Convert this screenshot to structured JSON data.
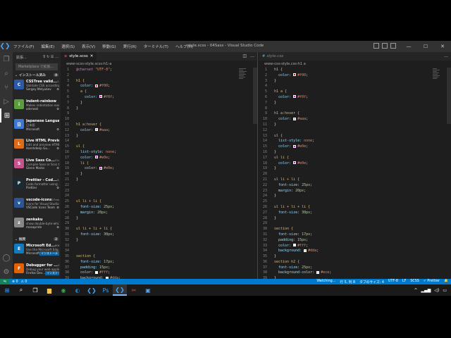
{
  "window": {
    "title": "style.scss - 04Sass - Visual Studio Code",
    "menus": [
      "ファイル(F)",
      "編集(E)",
      "選択(S)",
      "表示(V)",
      "移動(G)",
      "実行(R)",
      "ターミナル(T)",
      "ヘルプ(H)"
    ],
    "controls": {
      "minimize": "—",
      "maximize": "☐",
      "close": "✕"
    }
  },
  "sidebar": {
    "title": "拡張...",
    "search_placeholder": "Marketplace で拡張...",
    "installed_label": "インストール済み",
    "installed_count": "9",
    "recommended_label": "推奨",
    "recommended_count": "2",
    "extensions": [
      {
        "name": "CSSTree valid...",
        "meta": "116ms",
        "desc": "Validate CSS according...",
        "publisher": "Sergey Melyukov",
        "color": "#2a5aa8",
        "letter": "C"
      },
      {
        "name": "indent-rainbow",
        "meta": "",
        "desc": "Makes indentation easi...",
        "publisher": "oderwat",
        "color": "#5a9e3e",
        "letter": "i"
      },
      {
        "name": "Japanese Language P...",
        "meta": "",
        "desc": "日本語",
        "publisher": "Microsoft",
        "color": "#3c78d8",
        "letter": "日"
      },
      {
        "name": "Live HTML Previewer",
        "meta": "",
        "desc": "Edit and preview HTML...",
        "publisher": "Harshdeep Gu...",
        "color": "#e06c1a",
        "letter": "L"
      },
      {
        "name": "Live Sass Co...",
        "meta": "21ms",
        "desc": "Compile Sass or Scss t...",
        "publisher": "Glenn Marks",
        "color": "#c6538c",
        "letter": "S"
      },
      {
        "name": "Prettier - Cod...",
        "meta": "34ms",
        "desc": "Code formatter using ...",
        "publisher": "Prettier",
        "color": "#1a2b34",
        "letter": "P"
      },
      {
        "name": "vscode-icons",
        "meta": "27ms",
        "desc": "Icons for Visual Studio ...",
        "publisher": "VSCode Icons Team",
        "color": "#2b5797",
        "letter": "v"
      },
      {
        "name": "zenkaku",
        "meta": "",
        "desc": "show double-byte-whi...",
        "publisher": "mosapride",
        "color": "#888888",
        "letter": "z"
      }
    ],
    "recommended": [
      {
        "name": "Microsoft Ed...",
        "meta": "60K",
        "desc": "Use the Microsoft Edg...",
        "publisher": "Microsoft",
        "install": "インストール",
        "color": "#0f7bc2",
        "letter": "E"
      },
      {
        "name": "Debugger for ...",
        "meta": "2M",
        "desc": "Debug your web applic...",
        "publisher": "Firefox Dev...",
        "install": "インストール",
        "color": "#e66000",
        "letter": "F"
      }
    ]
  },
  "editor_left": {
    "tab": "style.scss",
    "breadcrumb": [
      "www",
      "scss",
      "style.scss",
      "h1",
      "a"
    ],
    "lines": [
      [
        "ln",
        "1",
        "@charset ",
        "kw",
        "\"UTF-8\"",
        "val",
        ";",
        "txt"
      ],
      [
        "ln",
        "2"
      ],
      [
        "ln",
        "3",
        "h1 {",
        "sel"
      ],
      [
        "ln",
        "4",
        "  color: ",
        "prop",
        "#f00",
        "val",
        ";",
        "txt"
      ],
      [
        "ln",
        "5",
        "  a {",
        "sel"
      ],
      [
        "ln",
        "6",
        "    color: ",
        "prop",
        "#f0f",
        "val",
        ";",
        "txt"
      ],
      [
        "ln",
        "7",
        "  }",
        "txt"
      ],
      [
        "ln",
        "8",
        "}",
        "txt"
      ],
      [
        "ln",
        "9"
      ],
      [
        "ln",
        "10"
      ],
      [
        "ln",
        "11",
        "h1 a:hover {",
        "sel"
      ],
      [
        "ln",
        "12",
        "  color: ",
        "prop",
        "#aaa",
        "val",
        ";",
        "txt"
      ],
      [
        "ln",
        "13",
        "}",
        "txt"
      ],
      [
        "ln",
        "14"
      ],
      [
        "ln",
        "15",
        "ul {",
        "sel"
      ],
      [
        "ln",
        "16",
        "  list-style: ",
        "prop",
        "none",
        "val",
        ";",
        "txt"
      ],
      [
        "ln",
        "17",
        "  color: ",
        "prop",
        "#e0e",
        "val",
        ";",
        "txt"
      ],
      [
        "ln",
        "18",
        "  li {",
        "sel"
      ],
      [
        "ln",
        "19",
        "    color: ",
        "prop",
        "#e0e",
        "val",
        ";",
        "txt"
      ],
      [
        "ln",
        "20",
        "  }",
        "txt"
      ],
      [
        "ln",
        "21",
        "}",
        "txt"
      ],
      [
        "ln",
        "22"
      ],
      [
        "ln",
        "23"
      ],
      [
        "ln",
        "24"
      ],
      [
        "ln",
        "25",
        "ul li + li {",
        "sel"
      ],
      [
        "ln",
        "26",
        "  font-size: ",
        "prop",
        "25px",
        "num",
        ";",
        "txt"
      ],
      [
        "ln",
        "27",
        "  margin: ",
        "prop",
        "20px",
        "num",
        ";",
        "txt"
      ],
      [
        "ln",
        "28",
        "}",
        "txt"
      ],
      [
        "ln",
        "29"
      ],
      [
        "ln",
        "30",
        "ul li + li + li {",
        "sel"
      ],
      [
        "ln",
        "31",
        "  font-size: ",
        "prop",
        "30px",
        "num",
        ";",
        "txt"
      ],
      [
        "ln",
        "32",
        "}",
        "txt"
      ],
      [
        "ln",
        "33"
      ],
      [
        "ln",
        "34"
      ],
      [
        "ln",
        "35",
        "section {",
        "sel"
      ],
      [
        "ln",
        "36",
        "  font-size: ",
        "prop",
        "17px",
        "num",
        ";",
        "txt"
      ],
      [
        "ln",
        "37",
        "  padding: ",
        "prop",
        "15px",
        "num",
        ";",
        "txt"
      ],
      [
        "ln",
        "38",
        "  color: ",
        "prop",
        "#fff",
        "val",
        ";",
        "txt"
      ],
      [
        "ln",
        "39",
        "  background: ",
        "prop",
        "#dda",
        "val",
        ";",
        "txt"
      ]
    ]
  },
  "editor_right": {
    "tab": "style.css",
    "breadcrumb": [
      "www",
      "css",
      "style.css",
      "h1 a"
    ],
    "lines": [
      [
        "ln",
        "1",
        "h1 {",
        "sel"
      ],
      [
        "ln",
        "2",
        "  color: ",
        "prop",
        "#f00",
        "val",
        ";",
        "txt"
      ],
      [
        "ln",
        "3",
        "}",
        "txt"
      ],
      [
        "ln",
        "4"
      ],
      [
        "ln",
        "5",
        "h1 a {",
        "sel"
      ],
      [
        "ln",
        "6",
        "  color: ",
        "prop",
        "#f0f",
        "val",
        ";",
        "txt"
      ],
      [
        "ln",
        "7",
        "}",
        "txt"
      ],
      [
        "ln",
        "8"
      ],
      [
        "ln",
        "9",
        "h1 a:hover {",
        "sel"
      ],
      [
        "ln",
        "10",
        "  color: ",
        "prop",
        "#aaa",
        "val",
        ";",
        "txt"
      ],
      [
        "ln",
        "11",
        "}",
        "txt"
      ],
      [
        "ln",
        "12"
      ],
      [
        "ln",
        "13",
        "ul {",
        "sel"
      ],
      [
        "ln",
        "14",
        "  list-style: ",
        "prop",
        "none",
        "val",
        ";",
        "txt"
      ],
      [
        "ln",
        "15",
        "  color: ",
        "prop",
        "#e0e",
        "val",
        ";",
        "txt"
      ],
      [
        "ln",
        "16",
        "}",
        "txt"
      ],
      [
        "ln",
        "17",
        "ul li {",
        "sel"
      ],
      [
        "ln",
        "18",
        "  color: ",
        "prop",
        "#e0e",
        "val",
        ";",
        "txt"
      ],
      [
        "ln",
        "19",
        "}",
        "txt"
      ],
      [
        "ln",
        "20"
      ],
      [
        "ln",
        "21",
        "ul li + li {",
        "sel"
      ],
      [
        "ln",
        "22",
        "  font-size: ",
        "prop",
        "25px",
        "num",
        ";",
        "txt"
      ],
      [
        "ln",
        "23",
        "  margin: ",
        "prop",
        "20px",
        "num",
        ";",
        "txt"
      ],
      [
        "ln",
        "24",
        "}",
        "txt"
      ],
      [
        "ln",
        "25"
      ],
      [
        "ln",
        "26",
        "ul li + li + li {",
        "sel"
      ],
      [
        "ln",
        "27",
        "  font-size: ",
        "prop",
        "30px",
        "num",
        ";",
        "txt"
      ],
      [
        "ln",
        "28",
        "}",
        "txt"
      ],
      [
        "ln",
        "29"
      ],
      [
        "ln",
        "30",
        "section {",
        "sel"
      ],
      [
        "ln",
        "31",
        "  font-size: ",
        "prop",
        "17px",
        "num",
        ";",
        "txt"
      ],
      [
        "ln",
        "32",
        "  padding: ",
        "prop",
        "15px",
        "num",
        ";",
        "txt"
      ],
      [
        "ln",
        "33",
        "  color: ",
        "prop",
        "#fff",
        "val",
        ";",
        "txt"
      ],
      [
        "ln",
        "34",
        "  background: ",
        "prop",
        "#dda",
        "val",
        ";",
        "txt"
      ],
      [
        "ln",
        "35",
        "}",
        "txt"
      ],
      [
        "ln",
        "36",
        "section h2 {",
        "sel"
      ],
      [
        "ln",
        "37",
        "  font-size: ",
        "prop",
        "25px",
        "num",
        ";",
        "txt"
      ],
      [
        "ln",
        "38",
        "  background-color: ",
        "prop",
        "#ece",
        "val",
        ";",
        "txt"
      ],
      [
        "ln",
        "39",
        "}",
        "txt"
      ]
    ]
  },
  "statusbar": {
    "left": [
      "⊗ 0",
      "⚠ 0"
    ],
    "right": [
      "Watching...",
      "行 5, 列 8",
      "タブのサイズ: 4",
      "UTF-8",
      "LF",
      "SCSS",
      "✓ Prettier",
      "🔔"
    ]
  },
  "taskbar": {
    "apps": [
      "windows-start",
      "search",
      "task-view",
      "explorer",
      "chrome",
      "edge",
      "vscode-alt",
      "photoshop",
      "vscode",
      "snipping",
      "photos"
    ],
    "time": "",
    "active_index": 8
  },
  "colors": {
    "accent": "#007acc",
    "sidebar": "#252526",
    "editor": "#1e1e1e"
  }
}
